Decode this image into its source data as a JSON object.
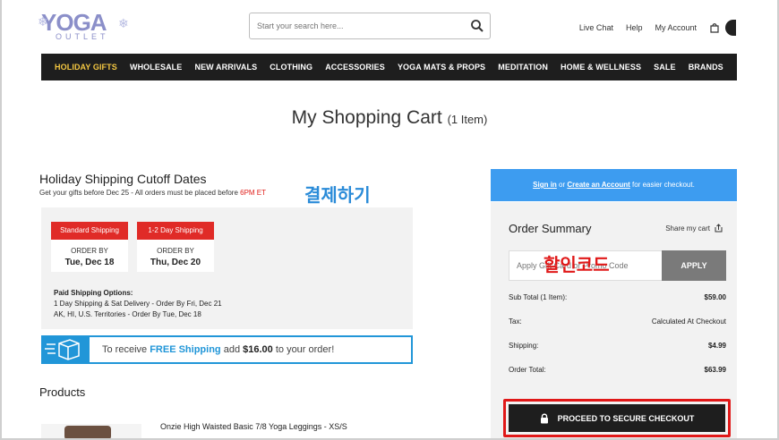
{
  "header": {
    "logo_text": "YOGA",
    "logo_sub": "OUTLET",
    "search_placeholder": "Start your search here...",
    "links": [
      "Live Chat",
      "Help",
      "My Account"
    ]
  },
  "nav": {
    "items": [
      "HOLIDAY GIFTS",
      "WHOLESALE",
      "NEW ARRIVALS",
      "CLOTHING",
      "ACCESSORIES",
      "YOGA MATS & PROPS",
      "MEDITATION",
      "HOME & WELLNESS",
      "SALE",
      "BRANDS"
    ],
    "active_color": "#f5c842"
  },
  "page": {
    "title": "My Shopping Cart",
    "item_count": "(1 Item)"
  },
  "holiday": {
    "title": "Holiday Shipping Cutoff Dates",
    "subtitle_prefix": "Get your gifts before Dec 25 - All orders must be placed before ",
    "subtitle_highlight": "6PM ET",
    "cards": [
      {
        "badge": "Standard Shipping",
        "order_by": "ORDER BY",
        "date": "Tue, Dec 18"
      },
      {
        "badge": "1-2 Day Shipping",
        "order_by": "ORDER BY",
        "date": "Thu, Dec 20"
      }
    ],
    "paid_heading": "Paid Shipping Options:",
    "paid_lines": [
      "1 Day Shipping & Sat Delivery - Order By Fri, Dec 21",
      "AK, HI, U.S. Territories - Order By Tue, Dec 18"
    ]
  },
  "annotations": {
    "checkout_korean": "결제하기",
    "promo_korean": "할인코드"
  },
  "free_shipping": {
    "prefix": "To receive ",
    "highlight": "FREE Shipping",
    "middle": " add ",
    "amount": "$16.00",
    "suffix": " to your order!"
  },
  "products": {
    "heading": "Products",
    "items": [
      {
        "name": "Onzie High Waisted Basic 7/8 Yoga Leggings - XS/S"
      }
    ]
  },
  "signin": {
    "sign_in": "Sign in",
    "or": " or ",
    "create": "Create an Account",
    "suffix": " for easier checkout."
  },
  "summary": {
    "title": "Order Summary",
    "share": "Share my cart",
    "promo_placeholder": "Apply Gift Card or Promo Code",
    "apply": "APPLY",
    "rows": [
      {
        "label": "Sub Total (1 Item):",
        "value": "$59.00"
      },
      {
        "label": "Tax:",
        "value": "Calculated At Checkout"
      },
      {
        "label": "Shipping:",
        "value": "$4.99"
      },
      {
        "label": "Order Total:",
        "value": "$63.99"
      }
    ],
    "checkout": "PROCEED TO SECURE CHECKOUT"
  },
  "colors": {
    "accent_blue": "#2196d8",
    "signin_blue": "#3d9cf0",
    "badge_red": "#e02b27",
    "annotation_red": "#e01818",
    "nav_bg": "#1e1e1e"
  }
}
